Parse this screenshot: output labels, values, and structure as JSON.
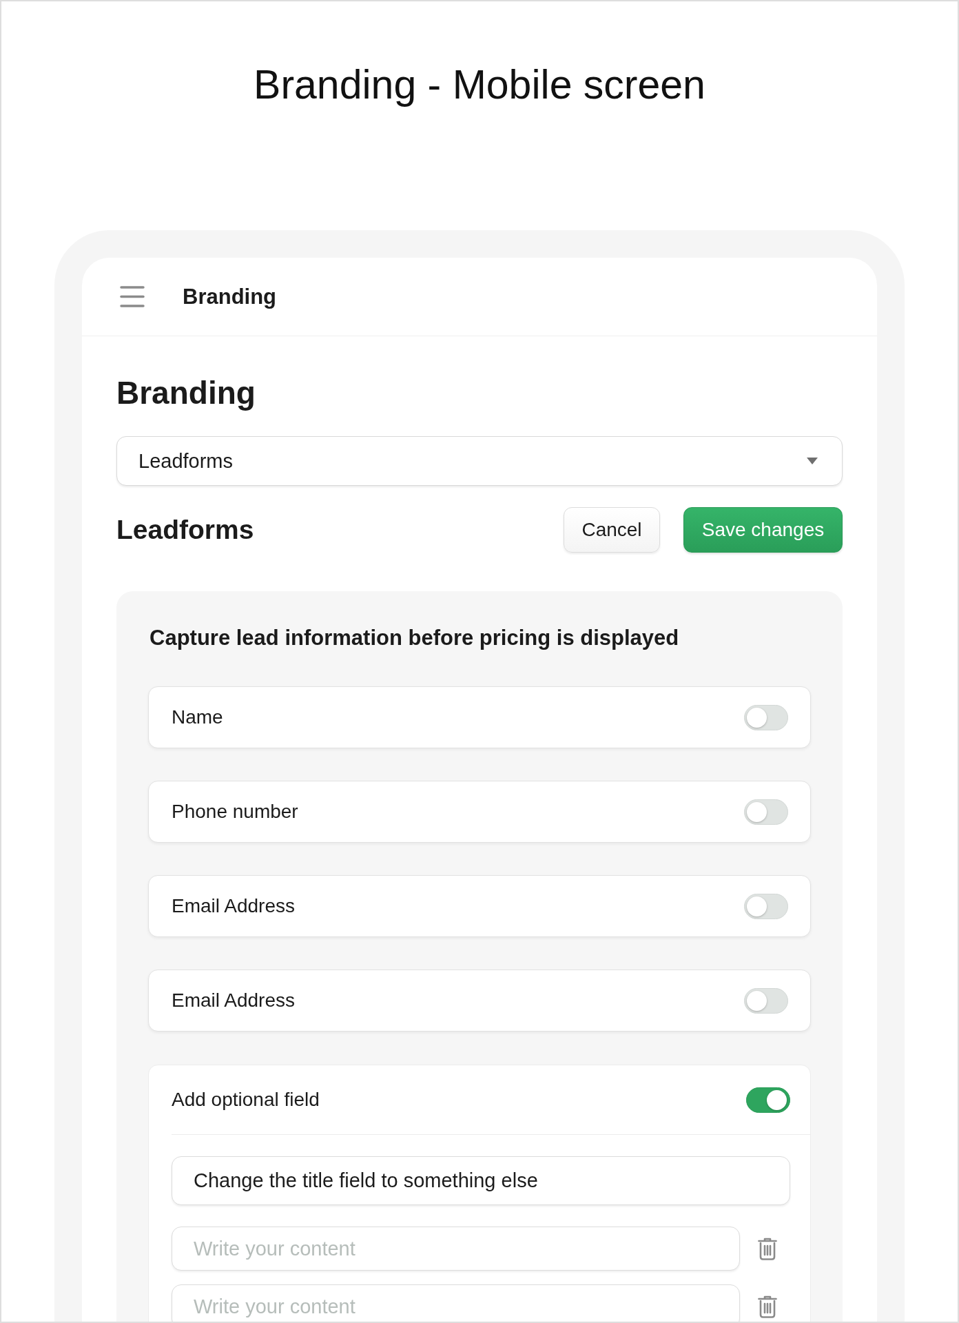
{
  "page_title": "Branding - Mobile screen",
  "app_bar": {
    "title": "Branding"
  },
  "heading": "Branding",
  "section_select": {
    "value": "Leadforms"
  },
  "section": {
    "title": "Leadforms",
    "buttons": [
      {
        "label": "Cancel",
        "kind": "secondary"
      },
      {
        "label": "Save changes",
        "kind": "primary"
      }
    ]
  },
  "lead_capture": {
    "title": "Capture lead information before pricing is displayed",
    "fields": [
      {
        "label": "Name",
        "on": false
      },
      {
        "label": "Phone number",
        "on": false
      },
      {
        "label": "Email Address",
        "on": false
      },
      {
        "label": "Email Address",
        "on": false
      }
    ],
    "optional_field": {
      "label": "Add optional field",
      "on": true,
      "title_input": {
        "value": "Change the title field to something else"
      },
      "content_inputs": [
        {
          "placeholder": "Write your content"
        },
        {
          "placeholder": "Write your content"
        }
      ]
    }
  }
}
